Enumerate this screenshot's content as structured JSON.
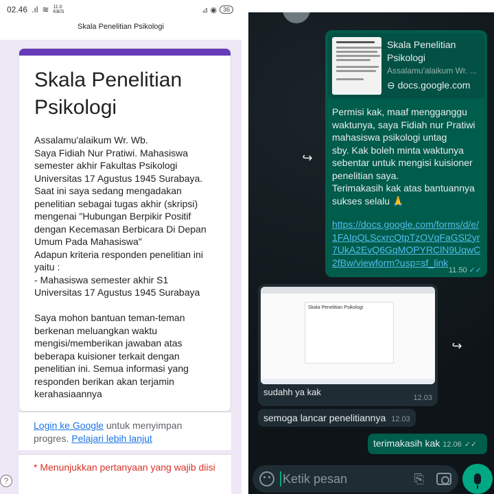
{
  "status_bar": {
    "time": "02.46",
    "signal": ".ıl",
    "wifi": "≋",
    "speed": "11.0 KB/S",
    "icons_right": "⊿ ◉",
    "battery": "36"
  },
  "browser": {
    "page_title": "Skala Penelitian Psikologi"
  },
  "form": {
    "title": "Skala Penelitian Psikologi",
    "description": "Assalamu'alaikum Wr. Wb.\nSaya Fidiah Nur Pratiwi. Mahasiswa semester akhir Fakultas Psikologi Universitas 17 Agustus 1945 Surabaya.\n Saat ini saya sedang mengadakan penelitian sebagai tugas akhir (skripsi) mengenai \"Hubungan Berpikir Positif dengan Kecemasan Berbicara Di Depan Umum Pada Mahasiswa\"\nAdapun kriteria responden penelitian ini yaitu :\n- Mahasiswa semester akhir S1 Universitas 17 Agustus 1945 Surabaya\n\nSaya mohon bantuan teman-teman\n berkenan meluangkan waktu mengisi/memberikan jawaban atas beberapa kuisioner terkait dengan penelitian ini. Semua informasi yang responden berikan akan terjamin kerahasiaannya",
    "login_link": "Login ke Google",
    "login_text": " untuk menyimpan progres. ",
    "learn_more": "Pelajari lebih lanjut",
    "required_note": "* Menunjukkan pertanyaan yang wajib diisi",
    "help_icon": "?"
  },
  "chat": {
    "link_preview": {
      "title": "Skala Penelitian Psikologi",
      "subtitle": "Assalamu'alaikum Wr. ...",
      "domain": "⊖ docs.google.com"
    },
    "message1_text": "Permisi kak, maaf mengganggu waktunya, saya Fidiah nur Pratiwi mahasiswa psikologi untag\nsby. Kak boleh minta waktunya sebentar untuk mengisi kuisioner penelitian saya.\nTerimakasih kak atas bantuannya sukses selalu 🙏",
    "message1_link": "https://docs.google.com/forms/d/e/1FAIpQLScxrcQtpTzOVqFaGSl2yr7UkA2EvQ6GqMOPYRClN9UqwC2fBw/viewform?usp=sf_link",
    "message1_time": "11.50",
    "ticks": "✓✓",
    "forward_icon": "↪",
    "image_caption": "sudahh ya kak",
    "image_time": "12.03",
    "image_doc_title": "Skala Penelitian Psikologi",
    "message2_text": "semoga lancar penelitiannya",
    "message2_time": "12.03",
    "message3_text": "terimakasih kak",
    "message3_time": "12.06",
    "input_placeholder": "Ketik pesan",
    "attach_glyph": "⎘"
  },
  "colors": {
    "form_accent": "#673ab7",
    "form_bg": "#ede7f6",
    "wa_outgoing": "#005c4b",
    "wa_incoming": "#202c33",
    "wa_green": "#00a884",
    "link_blue": "#53bdeb"
  }
}
